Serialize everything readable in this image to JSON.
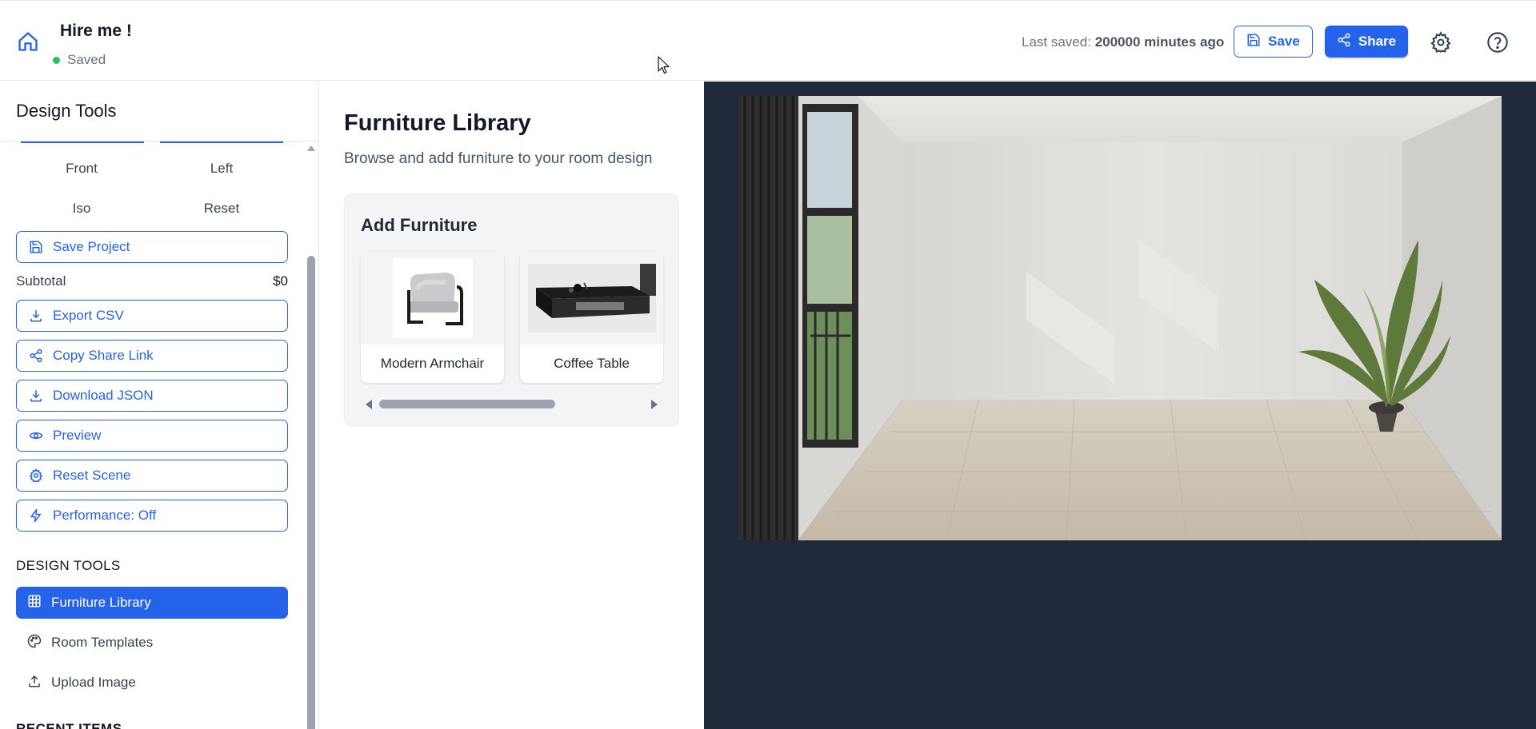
{
  "header": {
    "project_title": "Hire me !",
    "status": "Saved",
    "last_saved_label": "Last saved:",
    "last_saved_value": "200000 minutes ago",
    "save_label": "Save",
    "share_label": "Share"
  },
  "colors": {
    "accent": "#2563eb",
    "status_dot": "#22c55e",
    "canvas_bg": "#1e293b"
  },
  "sidebar": {
    "title": "Design Tools",
    "views": [
      "Front",
      "Left",
      "Iso",
      "Reset"
    ],
    "save_project": "Save Project",
    "subtotal_label": "Subtotal",
    "subtotal_value": "$0",
    "actions": [
      {
        "label": "Export CSV",
        "icon": "download-icon"
      },
      {
        "label": "Copy Share Link",
        "icon": "share-icon"
      },
      {
        "label": "Download JSON",
        "icon": "download-icon"
      },
      {
        "label": "Preview",
        "icon": "eye-icon"
      },
      {
        "label": "Reset Scene",
        "icon": "gear-icon"
      },
      {
        "label": "Performance: Off",
        "icon": "lightning-icon"
      }
    ],
    "section_label": "DESIGN TOOLS",
    "nav": [
      {
        "label": "Furniture Library",
        "icon": "grid-icon",
        "active": true
      },
      {
        "label": "Room Templates",
        "icon": "palette-icon",
        "active": false
      },
      {
        "label": "Upload Image",
        "icon": "upload-icon",
        "active": false
      }
    ],
    "next_section": "RECENT ITEMS"
  },
  "library": {
    "title": "Furniture Library",
    "subtitle": "Browse and add furniture to your room design",
    "add_title": "Add Furniture",
    "items": [
      {
        "name": "Modern Armchair"
      },
      {
        "name": "Coffee Table"
      }
    ]
  }
}
